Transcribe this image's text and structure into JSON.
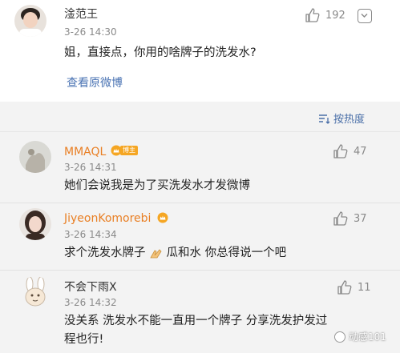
{
  "post": {
    "user": "淦范王",
    "time": "3-26 14:30",
    "likes": "192",
    "content": "姐，直接点，你用的啥牌子的洗发水?",
    "view_original": "查看原微博"
  },
  "sort": {
    "label": "按热度",
    "icon": "sort-lines-icon"
  },
  "comments": [
    {
      "user": "MMAQL",
      "badge": "博主",
      "time": "3-26 14:31",
      "likes": "47",
      "content": "她们会说我是为了买洗发水才发微博",
      "user_color": "#e97f24"
    },
    {
      "user": "JiyeonKomorebi",
      "time": "3-26 14:34",
      "likes": "37",
      "content_before": "求个洗发水牌子",
      "emoji": "pray-hands-icon",
      "content_after": "瓜和水 你总得说一个吧",
      "user_color": "#e97f24"
    },
    {
      "user": "不会下雨X",
      "time": "3-26 14:32",
      "likes": "11",
      "content_line1": "没关系 洗发水不能一直用一个牌子 分享洗发护发过",
      "content_line2": "程也行!",
      "user_color": "#333333"
    }
  ],
  "watermark": "动感101",
  "colors": {
    "link": "#4a73b3",
    "accent": "#e97f24",
    "badge": "#f5a623",
    "muted": "#8a8a8a"
  }
}
